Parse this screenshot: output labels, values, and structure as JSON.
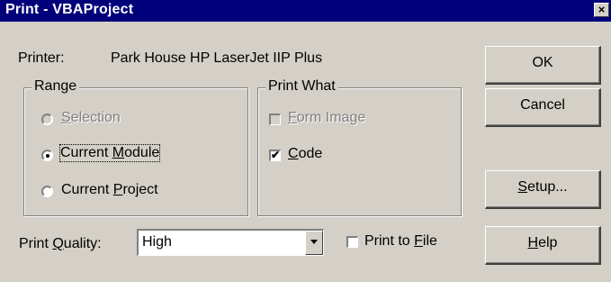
{
  "window": {
    "title": "Print - VBAProject",
    "close_symbol": "×"
  },
  "printer": {
    "label": "Printer:",
    "value": "Park House HP LaserJet IIP Plus"
  },
  "range": {
    "legend": "Range",
    "options": [
      {
        "label_pre": "",
        "label_key": "S",
        "label_post": "election",
        "selected": false,
        "enabled": false
      },
      {
        "label_pre": "Current ",
        "label_key": "M",
        "label_post": "odule",
        "selected": true,
        "enabled": true
      },
      {
        "label_pre": "Current ",
        "label_key": "P",
        "label_post": "roject",
        "selected": false,
        "enabled": true
      }
    ]
  },
  "print_what": {
    "legend": "Print What",
    "options": [
      {
        "label_pre": "",
        "label_key": "F",
        "label_post": "orm Image",
        "checked": false,
        "enabled": false
      },
      {
        "label_pre": "",
        "label_key": "C",
        "label_post": "ode",
        "checked": true,
        "enabled": true
      }
    ]
  },
  "quality": {
    "label_pre": "Print ",
    "label_key": "Q",
    "label_post": "uality:",
    "value": "High"
  },
  "print_to_file": {
    "label_pre": "Print to ",
    "label_key": "F",
    "label_post": "ile",
    "checked": false
  },
  "buttons": {
    "ok": "OK",
    "cancel": "Cancel",
    "setup_key": "S",
    "setup_post": "etup...",
    "help_key": "H",
    "help_post": "elp"
  }
}
